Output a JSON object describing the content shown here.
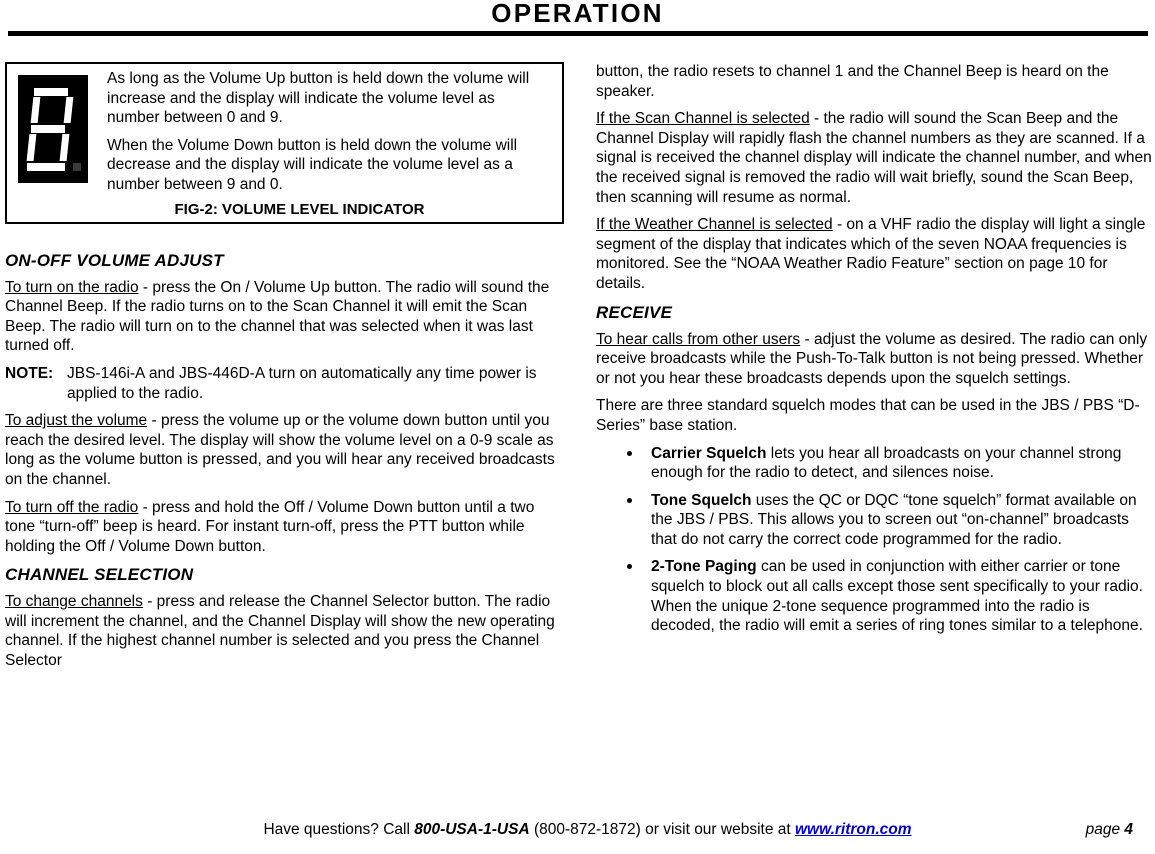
{
  "header": {
    "title": "OPERATION"
  },
  "figure": {
    "display_icon": "seven-segment-display-icon",
    "display_value": "8",
    "paragraphs": [
      "As long as the Volume Up button is held down the volume will increase and the display will indicate the volume level as number between 0 and 9.",
      "When the Volume Down button is held down the volume will decrease and the display will indicate the volume level as a number between 9 and 0."
    ],
    "caption": "FIG-2: VOLUME LEVEL INDICATOR"
  },
  "left_column": {
    "section1": {
      "heading": "ON-OFF VOLUME ADJUST",
      "p1_lead": "To turn on the radio",
      "p1_rest": " - press the On / Volume Up button. The radio will sound the Channel Beep. If the radio turns on to the Scan Channel it will emit the Scan Beep. The radio will turn on to the channel that was selected when it was last turned off.",
      "note_label": "NOTE:",
      "note_body": "JBS-146i-A and JBS-446D-A turn on automatically any time power is applied to the radio.",
      "p2_lead": "To adjust the volume",
      "p2_rest": " - press the volume up or the volume down button until you reach the desired level. The display will show the volume level on a 0-9 scale as long as the volume button is pressed, and you will hear any received broadcasts on the channel.",
      "p3_lead": "To turn off the radio",
      "p3_rest": " - press and hold the Off / Volume Down button until a two tone “turn-off” beep is heard. For instant turn-off, press the PTT button while holding the Off / Volume Down button."
    },
    "section2": {
      "heading": "CHANNEL SELECTION",
      "p1_lead": "To change channels",
      "p1_rest": " - press and release the Channel Selector button. The radio will increment the channel, and the Channel Display will show the new operating channel. If the highest channel number is selected and you press the Channel Selector"
    }
  },
  "right_column": {
    "continuation": "button, the radio resets to channel 1 and the Channel Beep is heard on the speaker.",
    "p_scan_lead": "If the Scan Channel is selected",
    "p_scan_rest": " - the radio will sound the Scan Beep and the Channel Display will rapidly flash the channel numbers as they are scanned. If a signal is received the channel display will indicate the channel number, and when the received signal is removed the radio will wait briefly, sound the Scan Beep, then scanning will resume as normal.",
    "p_weather_lead": "If the Weather Channel is selected",
    "p_weather_rest": " - on a VHF radio the display will light a single segment of the display that indicates which of the seven NOAA frequencies is monitored. See the “NOAA Weather Radio Feature” section on page 10 for details.",
    "section_receive": {
      "heading": "RECEIVE",
      "p1_lead": "To hear calls from other users",
      "p1_rest": " - adjust the volume as desired. The radio can only receive broadcasts while the Push-To-Talk button is not being pressed. Whether or not you hear these broadcasts depends upon the squelch settings.",
      "p2": "There are three standard squelch modes that can be used in the JBS / PBS “D-Series” base station.",
      "bullets": [
        {
          "term": "Carrier Squelch",
          "text": " lets you hear all broadcasts on your channel strong enough for the radio to detect, and silences noise."
        },
        {
          "term": "Tone Squelch",
          "text": " uses the QC or DQC “tone squelch” format available on the JBS / PBS. This allows you to screen out “on-channel” broadcasts that do not carry the correct code programmed for the radio."
        },
        {
          "term": "2-Tone Paging",
          "text": " can be used in conjunction with either carrier or tone squelch to block out all calls except those sent specifically to your radio. When the unique 2-tone sequence programmed into the radio is decoded, the radio will emit a series of ring tones similar to a telephone."
        }
      ]
    }
  },
  "footer": {
    "prefix": "Have questions?  Call ",
    "phone_bold": "800-USA-1-USA",
    "middle": " (800-872-1872) or visit our website at ",
    "website": "www.ritron.com",
    "page_label": "page ",
    "page_number": "4",
    "link_color": "#0000cc"
  }
}
